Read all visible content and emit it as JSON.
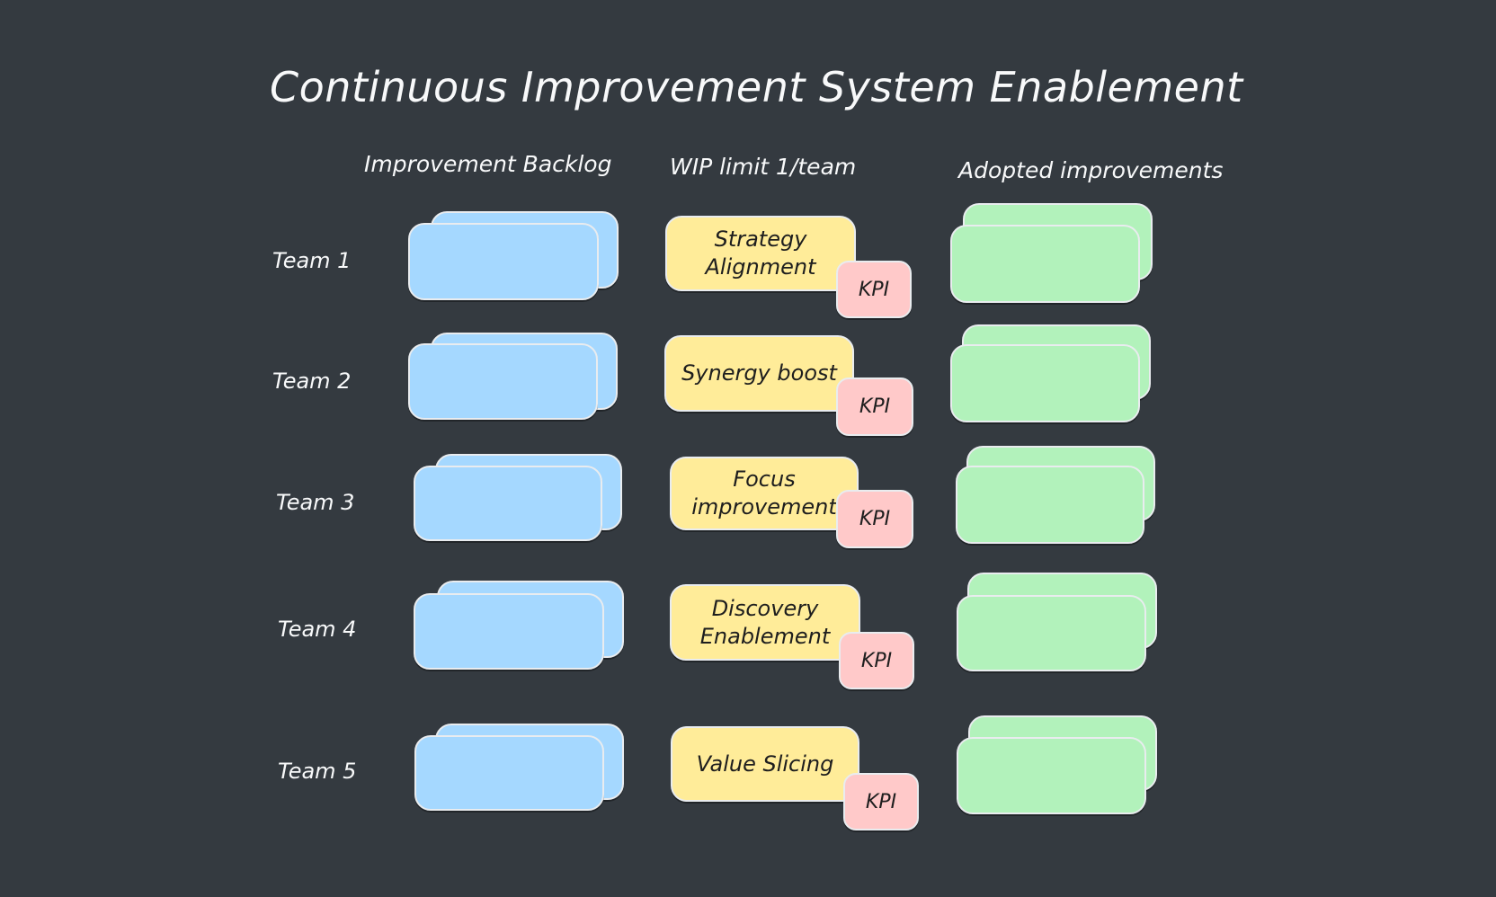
{
  "title": "Continuous Improvement System Enablement",
  "columns": {
    "backlog": "Improvement Backlog",
    "wip": "WIP limit 1/team",
    "adopted": "Adopted improvements"
  },
  "colors": {
    "background": "#343a40",
    "backlog_card": "#a5d8ff",
    "wip_card": "#ffec99",
    "kpi_badge": "#ffc9c9",
    "adopted_card": "#b2f2bb",
    "text_light": "#f8f9fa",
    "text_dark": "#1e1e1e"
  },
  "teams": [
    {
      "label": "Team 1",
      "wip_item": "Strategy Alignment",
      "kpi": "KPI"
    },
    {
      "label": "Team 2",
      "wip_item": "Synergy boost",
      "kpi": "KPI"
    },
    {
      "label": "Team 3",
      "wip_item": "Focus improvement",
      "kpi": "KPI"
    },
    {
      "label": "Team 4",
      "wip_item": "Discovery Enablement",
      "kpi": "KPI"
    },
    {
      "label": "Team 5",
      "wip_item": "Value Slicing",
      "kpi": "KPI"
    }
  ]
}
